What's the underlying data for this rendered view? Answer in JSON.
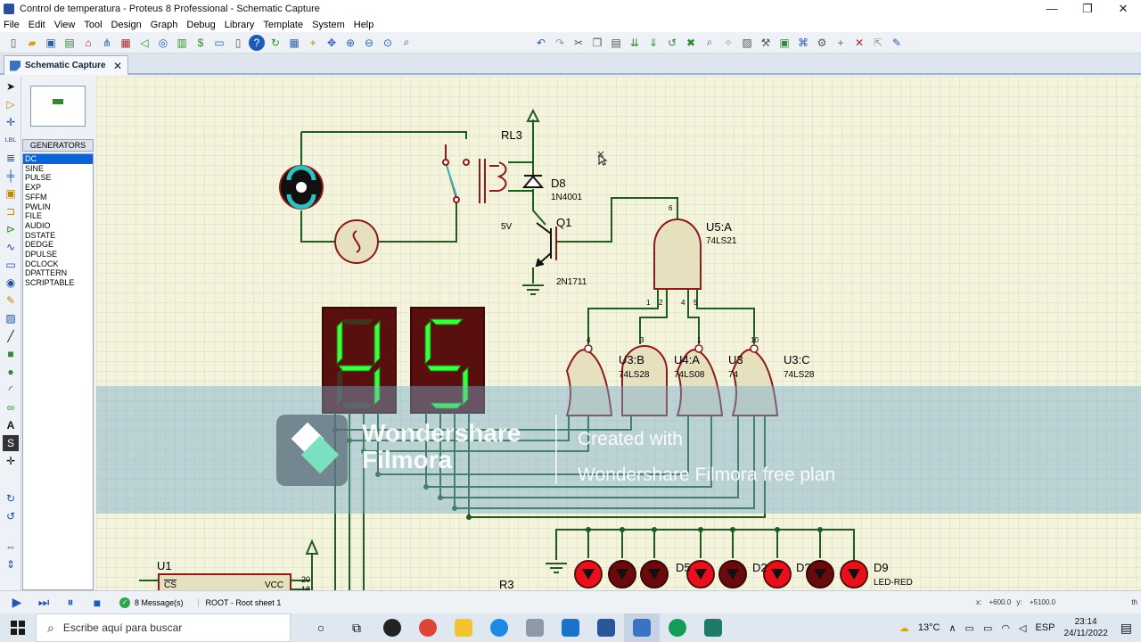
{
  "window": {
    "title": "Control de temperatura - Proteus 8 Professional - Schematic Capture",
    "controls": [
      "—",
      "❐",
      "✕"
    ]
  },
  "menu": [
    "File",
    "Edit",
    "View",
    "Tool",
    "Design",
    "Graph",
    "Debug",
    "Library",
    "Template",
    "System",
    "Help"
  ],
  "tab": {
    "label": "Schematic Capture",
    "close": "✕"
  },
  "generators": {
    "header": "GENERATORS",
    "items": [
      "DC",
      "SINE",
      "PULSE",
      "EXP",
      "SFFM",
      "PWLIN",
      "FILE",
      "AUDIO",
      "DSTATE",
      "DEDGE",
      "DPULSE",
      "DCLOCK",
      "DPATTERN",
      "SCRIPTABLE"
    ],
    "selected": "DC"
  },
  "schematic": {
    "relay": "RL3",
    "diode": {
      "ref": "D8",
      "value": "1N4001"
    },
    "supply": "5V",
    "transistor": {
      "ref": "Q1",
      "value": "2N1711"
    },
    "gate_u5a": {
      "ref": "U5:A",
      "value": "74LS21"
    },
    "gate_u3b": {
      "ref": "U3:B",
      "value": "74LS28"
    },
    "gate_u4a": {
      "ref": "U4:A",
      "value": "74LS08"
    },
    "gate_u3x": {
      "ref": "U3",
      "value": "74"
    },
    "gate_u3c": {
      "ref": "U3:C",
      "value": "74LS28"
    },
    "display_left": "4",
    "display_right": "5",
    "pins": {
      "p6": "6",
      "p1": "1",
      "p2": "2",
      "p4": "4",
      "p5": "5",
      "p4b": "4",
      "p3": "3",
      "p1b": "1",
      "p10": "10",
      "p5b": "5",
      "p6b": "6",
      "p3b": "3",
      "p8": "8",
      "p9": "9"
    },
    "chip_u1": {
      "ref": "U1",
      "pin_cs": "CS",
      "pin_vcc": "VCC",
      "pin_20": "20",
      "pin_18": "18"
    },
    "resistor": "R3",
    "leds_label": "LED-RED",
    "led_refs": [
      "D5",
      "D2",
      "D?",
      "D9"
    ]
  },
  "watermark": {
    "brand_line1": "Wondershare",
    "brand_line2": "Filmora",
    "text_line1": "Created with",
    "text_line2": "Wondershare Filmora free plan"
  },
  "status": {
    "messages": "8 Message(s)",
    "sheet": "ROOT - Root sheet 1",
    "x_label": "x:",
    "x_value": "+600.0",
    "y_label": "y:",
    "y_value": "+5100.0",
    "th": "th"
  },
  "taskbar": {
    "search_placeholder": "Escribe aquí para buscar",
    "weather": "13°C",
    "lang": "ESP",
    "time": "23:14",
    "date": "24/11/2022"
  },
  "colors": {
    "wire": "#1f5c1f",
    "component": "#8b1a1a",
    "gate_fill": "#e6e0bf",
    "grid": "#d9d9c8",
    "canvas": "#f4f4dc",
    "led_on": "#e8101a",
    "seg_on": "#3cff3c",
    "seg_bg": "#5a0f0f"
  }
}
